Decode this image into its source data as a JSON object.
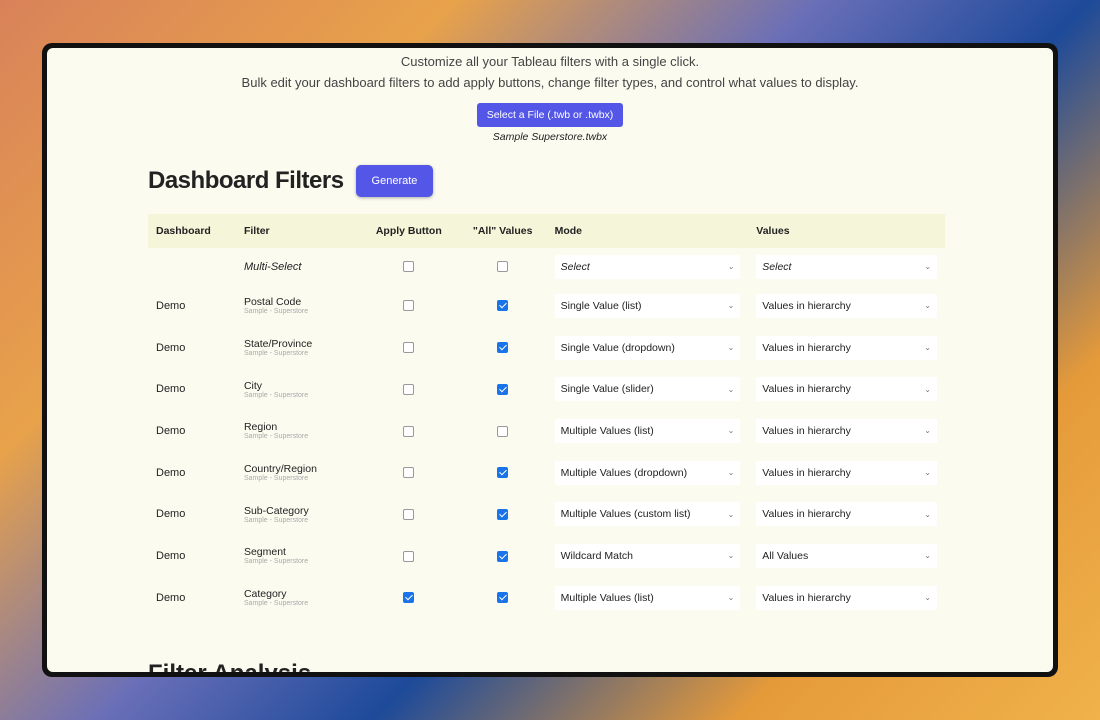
{
  "intro": {
    "line1": "Customize all your Tableau filters with a single click.",
    "line2": "Bulk edit your dashboard filters to add apply buttons, change filter types, and control what values to display."
  },
  "file": {
    "button": "Select a File (.twb or .twbx)",
    "name": "Sample Superstore.twbx"
  },
  "section": {
    "title": "Dashboard Filters",
    "generate": "Generate",
    "next_title": "Filter Analysis"
  },
  "columns": [
    "Dashboard",
    "Filter",
    "Apply Button",
    "\"All\" Values",
    "Mode",
    "Values"
  ],
  "multi": {
    "label": "Multi-Select",
    "mode": "Select",
    "values": "Select"
  },
  "rows": [
    {
      "dashboard": "Demo",
      "filter": "Postal Code",
      "source": "Sample - Superstore",
      "apply": false,
      "all": true,
      "mode": "Single Value (list)",
      "values": "Values in hierarchy"
    },
    {
      "dashboard": "Demo",
      "filter": "State/Province",
      "source": "Sample - Superstore",
      "apply": false,
      "all": true,
      "mode": "Single Value (dropdown)",
      "values": "Values in hierarchy"
    },
    {
      "dashboard": "Demo",
      "filter": "City",
      "source": "Sample - Superstore",
      "apply": false,
      "all": true,
      "mode": "Single Value (slider)",
      "values": "Values in hierarchy"
    },
    {
      "dashboard": "Demo",
      "filter": "Region",
      "source": "Sample - Superstore",
      "apply": false,
      "all": false,
      "mode": "Multiple Values (list)",
      "values": "Values in hierarchy"
    },
    {
      "dashboard": "Demo",
      "filter": "Country/Region",
      "source": "Sample - Superstore",
      "apply": false,
      "all": true,
      "mode": "Multiple Values (dropdown)",
      "values": "Values in hierarchy"
    },
    {
      "dashboard": "Demo",
      "filter": "Sub-Category",
      "source": "Sample - Superstore",
      "apply": false,
      "all": true,
      "mode": "Multiple Values (custom list)",
      "values": "Values in hierarchy"
    },
    {
      "dashboard": "Demo",
      "filter": "Segment",
      "source": "Sample - Superstore",
      "apply": false,
      "all": true,
      "mode": "Wildcard Match",
      "values": "All Values"
    },
    {
      "dashboard": "Demo",
      "filter": "Category",
      "source": "Sample - Superstore",
      "apply": true,
      "all": true,
      "mode": "Multiple Values (list)",
      "values": "Values in hierarchy"
    }
  ]
}
